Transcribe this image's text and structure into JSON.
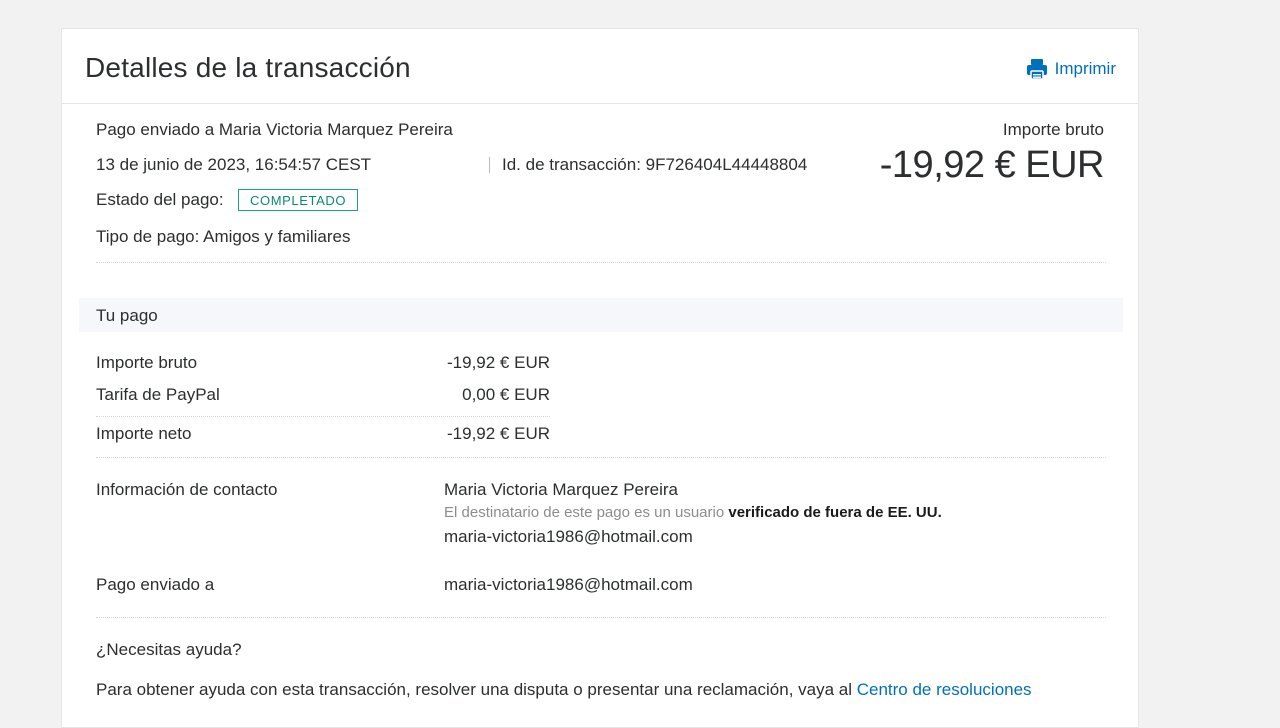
{
  "header": {
    "title": "Detalles de la transacción",
    "print_label": "Imprimir"
  },
  "summary": {
    "sent_to": "Pago enviado a Maria Victoria Marquez Pereira",
    "date": "13 de junio de 2023, 16:54:57 CEST",
    "transaction_id": "Id. de transacción: 9F726404L44448804",
    "status_label": "Estado del pago:",
    "status_badge": "COMPLETADO",
    "payment_type": "Tipo de pago: Amigos y familiares",
    "gross_label": "Importe bruto",
    "gross_amount": "-19,92 € EUR"
  },
  "your_payment": {
    "section_title": "Tu pago",
    "rows": [
      {
        "label": "Importe bruto",
        "value": "-19,92 € EUR"
      },
      {
        "label": "Tarifa de PayPal",
        "value": "0,00 € EUR"
      },
      {
        "label": "Importe neto",
        "value": "-19,92 € EUR"
      }
    ]
  },
  "contact": {
    "label": "Información de contacto",
    "name": "Maria Victoria Marquez Pereira",
    "note_prefix": "El destinatario de este pago es un usuario ",
    "note_bold": "verificado de fuera de EE. UU.",
    "email": "maria-victoria1986@hotmail.com"
  },
  "sent_to": {
    "label": "Pago enviado a",
    "email": "maria-victoria1986@hotmail.com"
  },
  "help": {
    "title": "¿Necesitas ayuda?",
    "text": "Para obtener ayuda con esta transacción, resolver una disputa o presentar una reclamación, vaya al ",
    "link": "Centro de resoluciones"
  },
  "colors": {
    "accent": "#0070ba",
    "badge": "#1aa18b",
    "band": "#f5f7fa"
  }
}
